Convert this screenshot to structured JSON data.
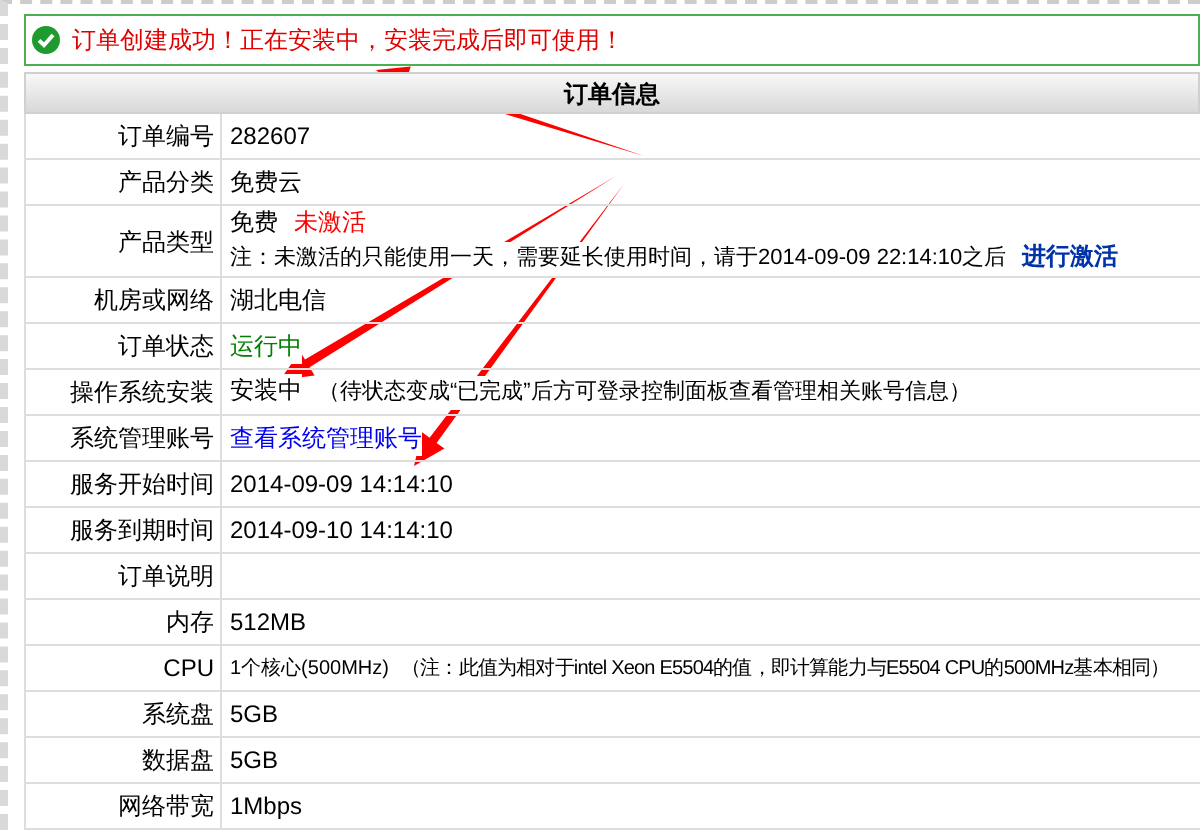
{
  "notice": {
    "text": "订单创建成功！正在安装中，安装完成后即可使用！"
  },
  "table": {
    "title": "订单信息",
    "rows": [
      {
        "label": "订单编号",
        "lines": [
          [
            {
              "kind": "text",
              "text": "282607"
            }
          ]
        ]
      },
      {
        "label": "产品分类",
        "lines": [
          [
            {
              "kind": "text",
              "text": "免费云"
            }
          ]
        ]
      },
      {
        "label": "产品类型",
        "lines": [
          [
            {
              "kind": "text",
              "text": "免费"
            },
            {
              "kind": "status",
              "text": "未激活",
              "color": "#ff0000"
            }
          ],
          [
            {
              "kind": "text",
              "text": "注：未激活的只能使用一天，需要延长使用时间，请于2014-09-09 22:14:10之后"
            },
            {
              "kind": "action_link",
              "text": "进行激活"
            }
          ]
        ]
      },
      {
        "label": "机房或网络",
        "lines": [
          [
            {
              "kind": "text",
              "text": "湖北电信"
            }
          ]
        ]
      },
      {
        "label": "订单状态",
        "lines": [
          [
            {
              "kind": "status",
              "text": "运行中",
              "color": "#008000"
            }
          ]
        ]
      },
      {
        "label": "操作系统安装",
        "lines": [
          [
            {
              "kind": "text",
              "text": "安装中"
            },
            {
              "kind": "text",
              "text": "（待状态变成“已完成”后方可登录控制面板查看管理相关账号信息）"
            }
          ]
        ]
      },
      {
        "label": "系统管理账号",
        "lines": [
          [
            {
              "kind": "link",
              "text": "查看系统管理账号"
            }
          ]
        ]
      },
      {
        "label": "服务开始时间",
        "lines": [
          [
            {
              "kind": "text",
              "text": "2014-09-09 14:14:10"
            }
          ]
        ]
      },
      {
        "label": "服务到期时间",
        "lines": [
          [
            {
              "kind": "text",
              "text": "2014-09-10 14:14:10"
            }
          ]
        ]
      },
      {
        "label": "订单说明"
      },
      {
        "label": "内存",
        "lines": [
          [
            {
              "kind": "text",
              "text": "512MB"
            }
          ]
        ]
      },
      {
        "label": "CPU",
        "lines": [
          [
            {
              "kind": "text",
              "text": "1个核心(500MHz)"
            },
            {
              "kind": "text",
              "text": "（注：此值为相对于intel Xeon E5504的值，即计算能力与E5504 CPU的500MHz基本相同）"
            }
          ]
        ]
      },
      {
        "label": "系统盘",
        "lines": [
          [
            {
              "kind": "text",
              "text": "5GB"
            }
          ]
        ]
      },
      {
        "label": "数据盘",
        "lines": [
          [
            {
              "kind": "text",
              "text": "5GB"
            }
          ]
        ]
      },
      {
        "label": "网络带宽",
        "lines": [
          [
            {
              "kind": "text",
              "text": "1Mbps"
            }
          ]
        ]
      }
    ]
  }
}
